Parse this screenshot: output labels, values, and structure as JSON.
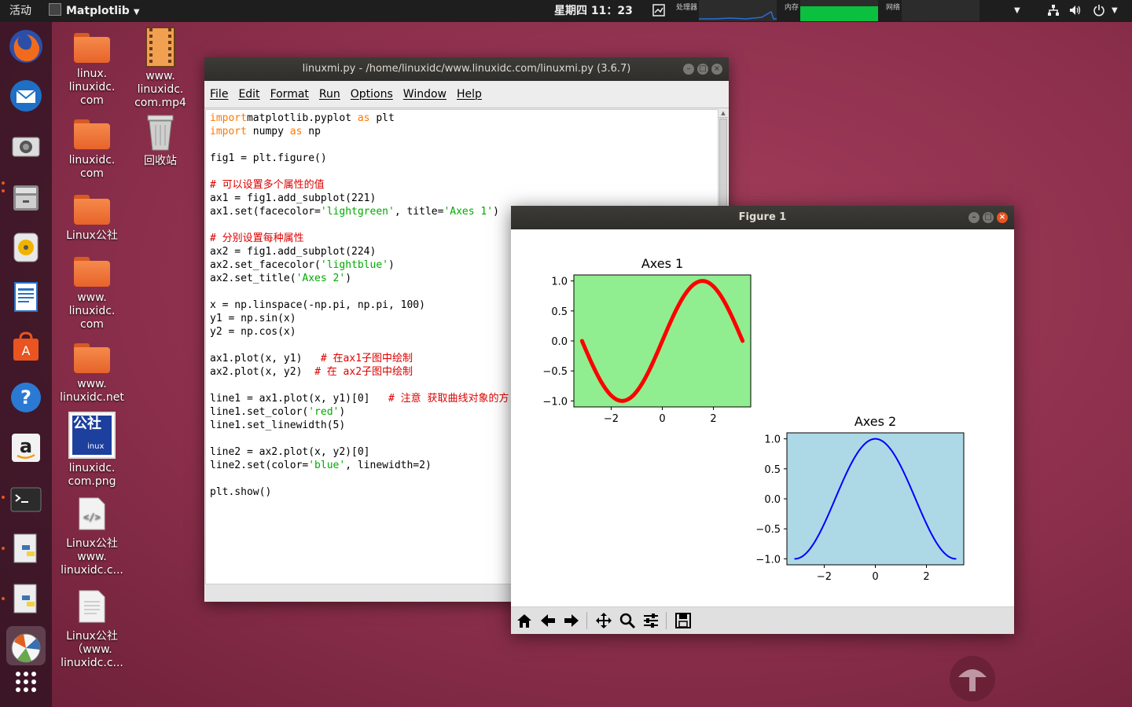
{
  "topbar": {
    "activities": "活动",
    "app_name": "Matplotlib",
    "clock": "星期四 11：23",
    "monitors": {
      "cpu": "处理器",
      "mem": "内存",
      "net": "网络"
    }
  },
  "desktop_icons": [
    {
      "label": "linux.\nlinuxidc.\ncom",
      "type": "folder"
    },
    {
      "label": "www.\nlinuxidc.\ncom.mp4",
      "type": "video"
    },
    {
      "label": "linuxidc.\ncom",
      "type": "folder"
    },
    {
      "label": "回收站",
      "type": "trash"
    },
    {
      "label": "Linux公社",
      "type": "folder"
    },
    {
      "label": "www.\nlinuxidc.\ncom",
      "type": "folder"
    },
    {
      "label": "www.\nlinuxidc.net",
      "type": "folder"
    },
    {
      "label": "linuxidc.\ncom.png",
      "type": "image"
    },
    {
      "label": "Linux公社\nwww.\nlinuxidc.c...",
      "type": "html"
    },
    {
      "label": "Linux公社\n（www.\nlinuxidc.c...",
      "type": "text"
    }
  ],
  "png_thumb_text": "公社",
  "png_thumb_sub": "inux",
  "idle": {
    "title": "linuxmi.py - /home/linuxidc/www.linuxidc.com/linuxmi.py (3.6.7)",
    "menu": [
      "File",
      "Edit",
      "Format",
      "Run",
      "Options",
      "Window",
      "Help"
    ],
    "code": [
      [
        [
          "kw",
          "import"
        ],
        [
          "",
          "matplotlib.pyplot "
        ],
        [
          "kw",
          "as"
        ],
        [
          "",
          " plt"
        ]
      ],
      [
        [
          "kw",
          "import"
        ],
        [
          "",
          " numpy "
        ],
        [
          "kw",
          "as"
        ],
        [
          "",
          " np"
        ]
      ],
      [],
      [
        [
          "",
          "fig1 = plt.figure()"
        ]
      ],
      [],
      [
        [
          "cm",
          "# 可以设置多个属性的值"
        ]
      ],
      [
        [
          "",
          "ax1 = fig1.add_subplot(221)"
        ]
      ],
      [
        [
          "",
          "ax1.set(facecolor="
        ],
        [
          "st",
          "'lightgreen'"
        ],
        [
          "",
          ", title="
        ],
        [
          "st",
          "'Axes 1'"
        ],
        [
          "",
          ")"
        ]
      ],
      [],
      [
        [
          "cm",
          "# 分别设置每种属性"
        ]
      ],
      [
        [
          "",
          "ax2 = fig1.add_subplot(224)"
        ]
      ],
      [
        [
          "",
          "ax2.set_facecolor("
        ],
        [
          "st",
          "'lightblue'"
        ],
        [
          "",
          ")"
        ]
      ],
      [
        [
          "",
          "ax2.set_title("
        ],
        [
          "st",
          "'Axes 2'"
        ],
        [
          "",
          ")"
        ]
      ],
      [],
      [
        [
          "",
          "x = np.linspace(-np.pi, np.pi, 100)"
        ]
      ],
      [
        [
          "",
          "y1 = np.sin(x)"
        ]
      ],
      [
        [
          "",
          "y2 = np.cos(x)"
        ]
      ],
      [],
      [
        [
          "",
          "ax1.plot(x, y1)   "
        ],
        [
          "cm",
          "# 在ax1子图中绘制"
        ]
      ],
      [
        [
          "",
          "ax2.plot(x, y2)  "
        ],
        [
          "cm",
          "# 在 ax2子图中绘制"
        ]
      ],
      [],
      [
        [
          "",
          "line1 = ax1.plot(x, y1)[0]   "
        ],
        [
          "cm",
          "# 注意 获取曲线对象的方"
        ]
      ],
      [
        [
          "",
          "line1.set_color("
        ],
        [
          "st",
          "'red'"
        ],
        [
          "",
          ")"
        ]
      ],
      [
        [
          "",
          "line1.set_linewidth(5)"
        ]
      ],
      [],
      [
        [
          "",
          "line2 = ax2.plot(x, y2)[0]"
        ]
      ],
      [
        [
          "",
          "line2.set(color="
        ],
        [
          "st",
          "'blue'"
        ],
        [
          "",
          ", linewidth=2)"
        ]
      ],
      [],
      [
        [
          "",
          "plt.show()"
        ]
      ]
    ]
  },
  "figure": {
    "title": "Figure 1",
    "toolbar": [
      "home-icon",
      "back-icon",
      "forward-icon",
      "pan-icon",
      "zoom-icon",
      "configure-icon",
      "save-icon"
    ]
  },
  "chart_data": [
    {
      "type": "line",
      "title": "Axes 1",
      "xlabel": "",
      "ylabel": "",
      "function": "sin(x)",
      "x_range": [
        -3.14159,
        3.14159
      ],
      "samples": 100,
      "xlim": [
        -3.46,
        3.46
      ],
      "ylim": [
        -1.1,
        1.1
      ],
      "xticks": [
        -2,
        0,
        2
      ],
      "yticks": [
        1.0,
        0.5,
        0.0,
        -0.5,
        -1.0
      ],
      "xtick_labels": [
        "−2",
        "0",
        "2"
      ],
      "ytick_labels": [
        "1.0",
        "0.5",
        "0.0",
        "−0.5",
        "−1.0"
      ],
      "facecolor": "#90ee90",
      "line_color": "#ff0000",
      "line_width": 5
    },
    {
      "type": "line",
      "title": "Axes 2",
      "xlabel": "",
      "ylabel": "",
      "function": "cos(x)",
      "x_range": [
        -3.14159,
        3.14159
      ],
      "samples": 100,
      "xlim": [
        -3.46,
        3.46
      ],
      "ylim": [
        -1.1,
        1.1
      ],
      "xticks": [
        -2,
        0,
        2
      ],
      "yticks": [
        1.0,
        0.5,
        0.0,
        -0.5,
        -1.0
      ],
      "xtick_labels": [
        "−2",
        "0",
        "2"
      ],
      "ytick_labels": [
        "1.0",
        "0.5",
        "0.0",
        "−0.5",
        "−1.0"
      ],
      "facecolor": "#add8e6",
      "line_color": "#0000ff",
      "line_width": 2
    }
  ]
}
